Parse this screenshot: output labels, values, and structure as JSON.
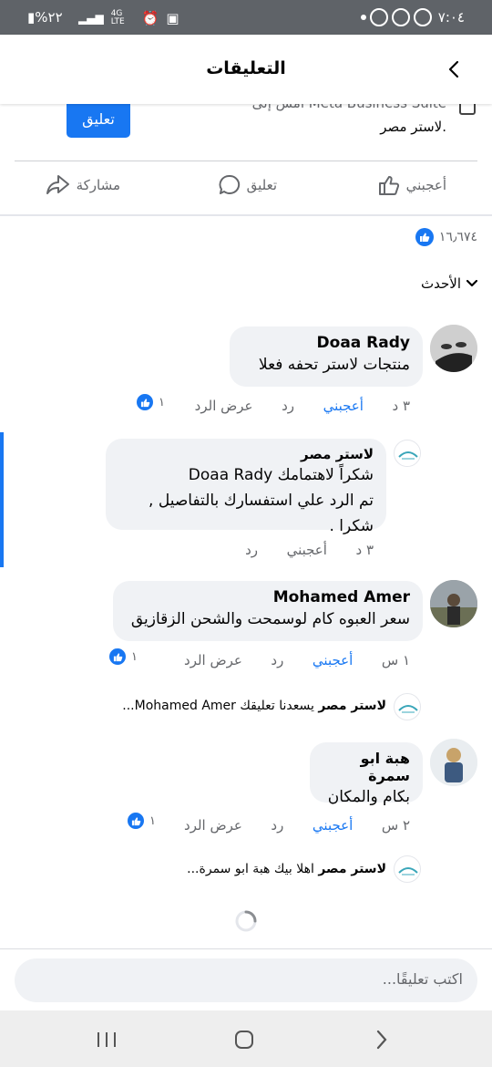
{
  "status_bar": {
    "time": "٧:٠٤",
    "battery": "%٢٢",
    "network": "4G LTE"
  },
  "header": {
    "title": "التعليقات",
    "back_icon": "chevron-left-icon"
  },
  "post_tail": {
    "cut_text": "أمس إلى Meta Business Suite",
    "brand": "لاستر مصر.",
    "comment_button": "تعليق"
  },
  "actions": {
    "like": "أعجبني",
    "comment": "تعليق",
    "share": "مشاركة"
  },
  "reactions": {
    "count": "١٦٫٦٧٤"
  },
  "sort": {
    "label": "الأحدث"
  },
  "comments": [
    {
      "name": "Doaa Rady",
      "text": "منتجات لاستر تحفه فعلا",
      "time": "٣ د",
      "like": "أعجبني",
      "reply": "رد",
      "view_replies": "عرض الرد",
      "likes": "١"
    },
    {
      "name": "لاستر مصر",
      "line1": "شكراً لاهتمامك  Doaa Rady",
      "line2": "تم الرد علي استفسارك بالتفاصيل , شكرا .",
      "time": "٣ د",
      "like": "أعجبني",
      "reply": "رد"
    },
    {
      "name": "Mohamed Amer",
      "text": "سعر العبوه كام لوسمحت والشحن الزقازيق",
      "time": "١ س",
      "like": "أعجبني",
      "reply": "رد",
      "view_replies": "عرض الرد",
      "likes": "١",
      "reply_author": "لاستر مصر",
      "reply_preview": "يسعدنا تعليقك  Mohamed Amer..."
    },
    {
      "name": "هبة ابو سمرة",
      "text": "بكام والمكان",
      "time": "٢ س",
      "like": "أعجبني",
      "reply": "رد",
      "view_replies": "عرض الرد",
      "likes": "١",
      "reply_author": "لاستر مصر",
      "reply_preview": "اهلا بيك  هبة ابو سمرة..."
    }
  ],
  "composer": {
    "placeholder": "اكتب تعليقًا..."
  },
  "colors": {
    "accent": "#1877f2",
    "bubble": "#f0f2f5",
    "muted": "#65676b"
  }
}
